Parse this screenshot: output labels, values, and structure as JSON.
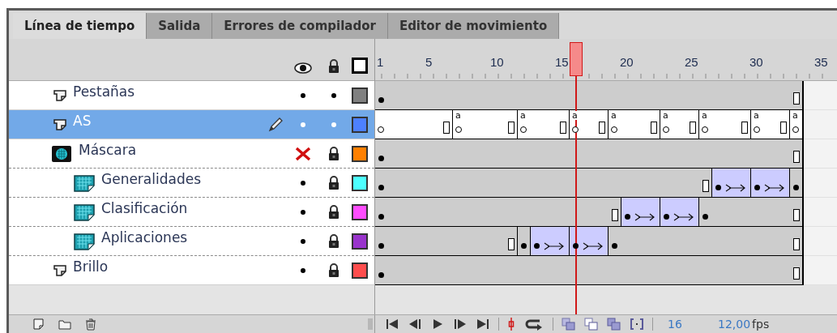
{
  "tabs": [
    {
      "label": "Línea de tiempo",
      "selected": true
    },
    {
      "label": "Salida",
      "selected": false
    },
    {
      "label": "Errores de compilador",
      "selected": false
    },
    {
      "label": "Editor de movimiento",
      "selected": false
    }
  ],
  "ruler": {
    "labels": [
      "1",
      "5",
      "10",
      "15",
      "20",
      "25",
      "30",
      "35"
    ]
  },
  "playhead": {
    "level": 0.435
  },
  "layers": [
    {
      "name": "Pestañas",
      "kind": "layer",
      "selected": false,
      "editing": false,
      "visible": true,
      "locked": false,
      "color": "#808080",
      "frames": [
        {
          "kind": "keyframe"
        },
        {
          "kind": "frame"
        },
        {
          "kind": "frame"
        },
        {
          "kind": "frame"
        },
        {
          "kind": "frame"
        },
        {
          "kind": "frame"
        },
        {
          "kind": "frame"
        },
        {
          "kind": "frame"
        },
        {
          "kind": "frame"
        },
        {
          "kind": "frame"
        },
        {
          "kind": "frame"
        },
        {
          "kind": "frame"
        },
        {
          "kind": "frame"
        },
        {
          "kind": "frame"
        },
        {
          "kind": "frame"
        },
        {
          "kind": "frame"
        },
        {
          "kind": "frame"
        },
        {
          "kind": "frame"
        },
        {
          "kind": "frame"
        },
        {
          "kind": "frame"
        },
        {
          "kind": "frame"
        },
        {
          "kind": "frame"
        },
        {
          "kind": "frame"
        },
        {
          "kind": "frame"
        },
        {
          "kind": "frame"
        },
        {
          "kind": "frame"
        },
        {
          "kind": "frame"
        },
        {
          "kind": "frame"
        },
        {
          "kind": "frame"
        },
        {
          "kind": "frame"
        },
        {
          "kind": "frame"
        },
        {
          "kind": "frame"
        },
        {
          "kind": "end"
        }
      ]
    },
    {
      "name": "AS",
      "kind": "layer",
      "selected": true,
      "editing": true,
      "visible": true,
      "locked": false,
      "color": "#4d80ff",
      "frames": [
        {
          "kind": "blank-keyframe"
        },
        {
          "kind": "frame"
        },
        {
          "kind": "frame"
        },
        {
          "kind": "frame"
        },
        {
          "kind": "frame"
        },
        {
          "kind": "end"
        },
        {
          "kind": "script-keyframe",
          "label": "a"
        },
        {
          "kind": "frame"
        },
        {
          "kind": "frame"
        },
        {
          "kind": "frame"
        },
        {
          "kind": "end"
        },
        {
          "kind": "script-keyframe",
          "label": "a"
        },
        {
          "kind": "frame"
        },
        {
          "kind": "frame"
        },
        {
          "kind": "end"
        },
        {
          "kind": "script-keyframe",
          "label": "a"
        },
        {
          "kind": "frame"
        },
        {
          "kind": "end"
        },
        {
          "kind": "script-keyframe",
          "label": "a"
        },
        {
          "kind": "frame"
        },
        {
          "kind": "frame"
        },
        {
          "kind": "end"
        },
        {
          "kind": "script-keyframe",
          "label": "a"
        },
        {
          "kind": "frame"
        },
        {
          "kind": "end"
        },
        {
          "kind": "script-keyframe",
          "label": "a"
        },
        {
          "kind": "frame"
        },
        {
          "kind": "frame"
        },
        {
          "kind": "end"
        },
        {
          "kind": "script-keyframe",
          "label": "a"
        },
        {
          "kind": "frame"
        },
        {
          "kind": "end"
        },
        {
          "kind": "script-keyframe",
          "label": "a"
        }
      ]
    },
    {
      "name": "Máscara",
      "kind": "mask",
      "selected": false,
      "editing": false,
      "visible": false,
      "locked": true,
      "color": "#ff8000",
      "frames": [
        {
          "kind": "keyframe"
        },
        {
          "kind": "frame"
        },
        {
          "kind": "frame"
        },
        {
          "kind": "frame"
        },
        {
          "kind": "frame"
        },
        {
          "kind": "frame"
        },
        {
          "kind": "frame"
        },
        {
          "kind": "frame"
        },
        {
          "kind": "frame"
        },
        {
          "kind": "frame"
        },
        {
          "kind": "frame"
        },
        {
          "kind": "frame"
        },
        {
          "kind": "frame"
        },
        {
          "kind": "frame"
        },
        {
          "kind": "frame"
        },
        {
          "kind": "frame"
        },
        {
          "kind": "frame"
        },
        {
          "kind": "frame"
        },
        {
          "kind": "frame"
        },
        {
          "kind": "frame"
        },
        {
          "kind": "frame"
        },
        {
          "kind": "frame"
        },
        {
          "kind": "frame"
        },
        {
          "kind": "frame"
        },
        {
          "kind": "frame"
        },
        {
          "kind": "frame"
        },
        {
          "kind": "frame"
        },
        {
          "kind": "frame"
        },
        {
          "kind": "frame"
        },
        {
          "kind": "frame"
        },
        {
          "kind": "frame"
        },
        {
          "kind": "frame"
        },
        {
          "kind": "end"
        }
      ],
      "children": [
        {
          "name": "Generalidades",
          "kind": "masked",
          "selected": false,
          "editing": false,
          "visible": true,
          "locked": true,
          "color": "#4dffff",
          "frames": [
            {
              "kind": "keyframe"
            },
            {
              "kind": "frame"
            },
            {
              "kind": "frame"
            },
            {
              "kind": "frame"
            },
            {
              "kind": "frame"
            },
            {
              "kind": "frame"
            },
            {
              "kind": "frame"
            },
            {
              "kind": "frame"
            },
            {
              "kind": "frame"
            },
            {
              "kind": "frame"
            },
            {
              "kind": "frame"
            },
            {
              "kind": "frame"
            },
            {
              "kind": "frame"
            },
            {
              "kind": "frame"
            },
            {
              "kind": "frame"
            },
            {
              "kind": "frame"
            },
            {
              "kind": "frame"
            },
            {
              "kind": "frame"
            },
            {
              "kind": "frame"
            },
            {
              "kind": "frame"
            },
            {
              "kind": "frame"
            },
            {
              "kind": "frame"
            },
            {
              "kind": "frame"
            },
            {
              "kind": "frame"
            },
            {
              "kind": "frame"
            },
            {
              "kind": "end"
            },
            {
              "kind": "tween-keyframe"
            },
            {
              "kind": "frame"
            },
            {
              "kind": "frame"
            },
            {
              "kind": "tween-keyframe"
            },
            {
              "kind": "frame"
            },
            {
              "kind": "frame"
            },
            {
              "kind": "keyframe"
            }
          ]
        },
        {
          "name": "Clasificación",
          "kind": "masked",
          "selected": false,
          "editing": false,
          "visible": true,
          "locked": true,
          "color": "#ff4dff",
          "frames": [
            {
              "kind": "keyframe"
            },
            {
              "kind": "frame"
            },
            {
              "kind": "frame"
            },
            {
              "kind": "frame"
            },
            {
              "kind": "frame"
            },
            {
              "kind": "frame"
            },
            {
              "kind": "frame"
            },
            {
              "kind": "frame"
            },
            {
              "kind": "frame"
            },
            {
              "kind": "frame"
            },
            {
              "kind": "frame"
            },
            {
              "kind": "frame"
            },
            {
              "kind": "frame"
            },
            {
              "kind": "frame"
            },
            {
              "kind": "frame"
            },
            {
              "kind": "frame"
            },
            {
              "kind": "frame"
            },
            {
              "kind": "frame"
            },
            {
              "kind": "end"
            },
            {
              "kind": "tween-keyframe"
            },
            {
              "kind": "frame"
            },
            {
              "kind": "frame"
            },
            {
              "kind": "tween-keyframe"
            },
            {
              "kind": "frame"
            },
            {
              "kind": "frame"
            },
            {
              "kind": "keyframe"
            },
            {
              "kind": "frame"
            },
            {
              "kind": "frame"
            },
            {
              "kind": "frame"
            },
            {
              "kind": "frame"
            },
            {
              "kind": "frame"
            },
            {
              "kind": "frame"
            },
            {
              "kind": "end"
            }
          ]
        },
        {
          "name": "Aplicaciones",
          "kind": "masked",
          "selected": false,
          "editing": false,
          "visible": true,
          "locked": true,
          "color": "#9933cc",
          "frames": [
            {
              "kind": "keyframe"
            },
            {
              "kind": "frame"
            },
            {
              "kind": "frame"
            },
            {
              "kind": "frame"
            },
            {
              "kind": "frame"
            },
            {
              "kind": "frame"
            },
            {
              "kind": "frame"
            },
            {
              "kind": "frame"
            },
            {
              "kind": "frame"
            },
            {
              "kind": "frame"
            },
            {
              "kind": "end"
            },
            {
              "kind": "keyframe"
            },
            {
              "kind": "tween-keyframe"
            },
            {
              "kind": "frame"
            },
            {
              "kind": "frame"
            },
            {
              "kind": "tween-keyframe"
            },
            {
              "kind": "frame"
            },
            {
              "kind": "frame"
            },
            {
              "kind": "keyframe"
            },
            {
              "kind": "frame"
            },
            {
              "kind": "frame"
            },
            {
              "kind": "frame"
            },
            {
              "kind": "frame"
            },
            {
              "kind": "frame"
            },
            {
              "kind": "frame"
            },
            {
              "kind": "frame"
            },
            {
              "kind": "frame"
            },
            {
              "kind": "frame"
            },
            {
              "kind": "frame"
            },
            {
              "kind": "frame"
            },
            {
              "kind": "frame"
            },
            {
              "kind": "frame"
            },
            {
              "kind": "end"
            }
          ]
        }
      ]
    },
    {
      "name": "Brillo",
      "kind": "layer",
      "selected": false,
      "editing": false,
      "visible": true,
      "locked": true,
      "color": "#ff4d4d",
      "frames": [
        {
          "kind": "keyframe"
        },
        {
          "kind": "frame"
        },
        {
          "kind": "frame"
        },
        {
          "kind": "frame"
        },
        {
          "kind": "frame"
        },
        {
          "kind": "frame"
        },
        {
          "kind": "frame"
        },
        {
          "kind": "frame"
        },
        {
          "kind": "frame"
        },
        {
          "kind": "frame"
        },
        {
          "kind": "frame"
        },
        {
          "kind": "frame"
        },
        {
          "kind": "frame"
        },
        {
          "kind": "frame"
        },
        {
          "kind": "frame"
        },
        {
          "kind": "frame"
        },
        {
          "kind": "frame"
        },
        {
          "kind": "frame"
        },
        {
          "kind": "frame"
        },
        {
          "kind": "frame"
        },
        {
          "kind": "frame"
        },
        {
          "kind": "frame"
        },
        {
          "kind": "frame"
        },
        {
          "kind": "frame"
        },
        {
          "kind": "frame"
        },
        {
          "kind": "frame"
        },
        {
          "kind": "frame"
        },
        {
          "kind": "frame"
        },
        {
          "kind": "frame"
        },
        {
          "kind": "frame"
        },
        {
          "kind": "frame"
        },
        {
          "kind": "frame"
        },
        {
          "kind": "end"
        }
      ]
    }
  ],
  "toolbar": {
    "current_frame": "16",
    "frame_rate": "12,00",
    "rate_unit": "fps"
  }
}
